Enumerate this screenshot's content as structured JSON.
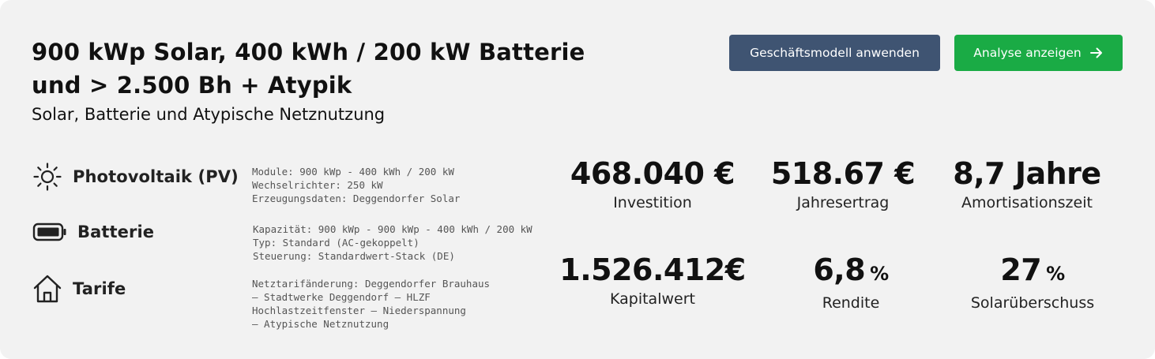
{
  "header": {
    "title_line1": "900 kWp Solar, 400 kWh / 200 kW Batterie",
    "title_line2": "und > 2.500 Bh + Atypik",
    "subtitle": "Solar, Batterie und Atypische Netznutzung"
  },
  "actions": {
    "apply_model_label": "Geschäftsmodell anwenden",
    "show_analysis_label": "Analyse anzeigen",
    "primary_color": "#1aab45",
    "secondary_color": "#3f5472"
  },
  "components": [
    {
      "label": "Photovoltaik (PV)",
      "icon": "sun-icon",
      "details": [
        "Module: 900 kWp - 400 kWh / 200 kW",
        "Wechselrichter: 250 kW",
        "Erzeugungsdaten: Deggendorfer Solar"
      ]
    },
    {
      "label": "Batterie",
      "icon": "battery-icon",
      "details": [
        "Kapazität: 900 kWp - 900 kWp - 400 kWh / 200 kW",
        "Typ: Standard (AC-gekoppelt)",
        "Steuerung: Standardwert-Stack (DE)"
      ]
    },
    {
      "label": "Tarife",
      "icon": "house-icon",
      "details": [
        "Netztarifänderung: Deggendorfer Brauhaus",
        "– Stadtwerke Deggendorf – HLZF",
        "Hochlastzeitfenster – Niederspannung",
        "– Atypische Netznutzung"
      ]
    }
  ],
  "metrics": [
    {
      "value": "468.040 €",
      "unit": "",
      "label": "Investition"
    },
    {
      "value": "518.67 €",
      "unit": "",
      "label": "Jahresertrag"
    },
    {
      "value": "8,7 Jahre",
      "unit": "",
      "label": "Amortisationszeit"
    },
    {
      "value": "1.526.412€",
      "unit": "",
      "label": "Kapitalwert"
    },
    {
      "value": "6,8",
      "unit": "%",
      "label": "Rendite"
    },
    {
      "value": "27",
      "unit": "%",
      "label": "Solarüberschuss"
    }
  ]
}
